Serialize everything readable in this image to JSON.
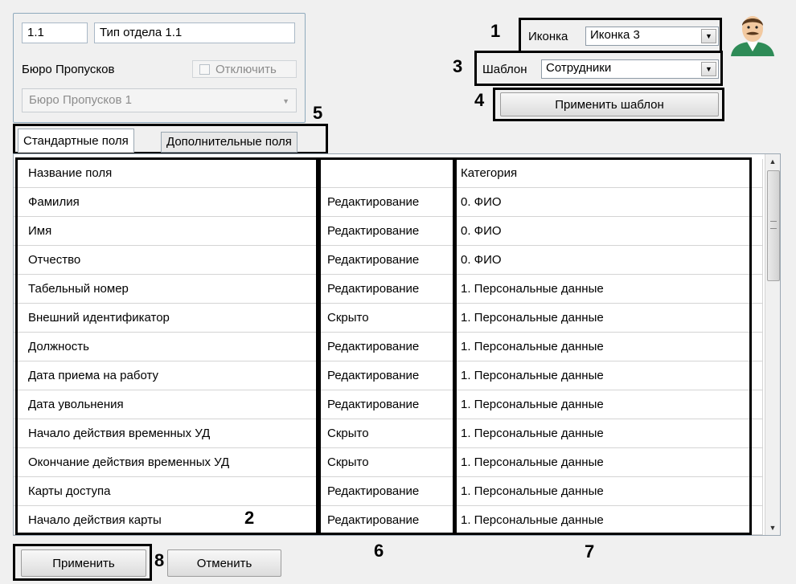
{
  "group": {
    "code": "1.1",
    "name": "Тип отдела 1.1",
    "department_label": "Бюро Пропусков",
    "disable_label": "Отключить",
    "department_select": "Бюро Пропусков 1"
  },
  "icon": {
    "label": "Иконка",
    "value": "Иконка 3"
  },
  "template": {
    "label": "Шаблон",
    "value": "Сотрудники",
    "apply_label": "Применить шаблон"
  },
  "tabs": [
    "Стандартные поля",
    "Дополнительные поля"
  ],
  "grid": {
    "headers": [
      "Название поля",
      "",
      "Категория"
    ],
    "rows": [
      {
        "name": "Фамилия",
        "mode": "Редактирование",
        "category": "0. ФИО"
      },
      {
        "name": "Имя",
        "mode": "Редактирование",
        "category": "0. ФИО"
      },
      {
        "name": "Отчество",
        "mode": "Редактирование",
        "category": "0. ФИО"
      },
      {
        "name": "Табельный номер",
        "mode": "Редактирование",
        "category": "1. Персональные данные"
      },
      {
        "name": "Внешний идентификатор",
        "mode": "Скрыто",
        "category": "1. Персональные данные"
      },
      {
        "name": "Должность",
        "mode": "Редактирование",
        "category": "1. Персональные данные"
      },
      {
        "name": "Дата приема на работу",
        "mode": "Редактирование",
        "category": "1. Персональные данные"
      },
      {
        "name": "Дата увольнения",
        "mode": "Редактирование",
        "category": "1. Персональные данные"
      },
      {
        "name": "Начало действия временных УД",
        "mode": "Скрыто",
        "category": "1. Персональные данные"
      },
      {
        "name": "Окончание действия временных УД",
        "mode": "Скрыто",
        "category": "1. Персональные данные"
      },
      {
        "name": "Карты доступа",
        "mode": "Редактирование",
        "category": "1. Персональные данные"
      },
      {
        "name": "Начало действия карты",
        "mode": "Редактирование",
        "category": "1. Персональные данные"
      }
    ]
  },
  "footer": {
    "apply": "Применить",
    "cancel": "Отменить"
  },
  "callouts": {
    "n1": "1",
    "n2": "2",
    "n3": "3",
    "n4": "4",
    "n5": "5",
    "n6": "6",
    "n7": "7",
    "n8": "8"
  },
  "colors": {
    "callout": "#000000",
    "panel_border": "#8faabd",
    "background": "#f0f0f0"
  },
  "icons": {
    "avatar": "person-avatar-icon",
    "combo_arrow": "chevron-down-icon"
  }
}
